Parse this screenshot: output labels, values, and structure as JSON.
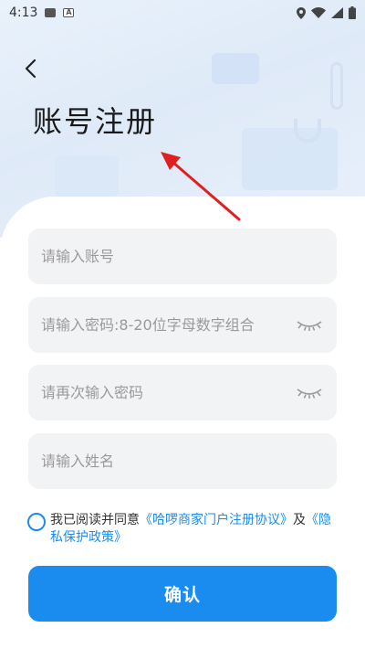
{
  "status_bar": {
    "time": "4:13"
  },
  "header": {
    "title": "账号注册"
  },
  "form": {
    "account_placeholder": "请输入账号",
    "password_placeholder": "请输入密码:8-20位字母数字组合",
    "confirm_password_placeholder": "请再次输入密码",
    "name_placeholder": "请输入姓名"
  },
  "agreement": {
    "prefix": "我已阅读并同意",
    "user_agreement": "《哈啰商家门户注册协议》",
    "conjunction": "及",
    "privacy_policy": "《隐私保护政策》"
  },
  "confirm_button": {
    "label": "确认"
  },
  "colors": {
    "accent": "#1a8cf0",
    "annotation_arrow": "#e02020"
  }
}
